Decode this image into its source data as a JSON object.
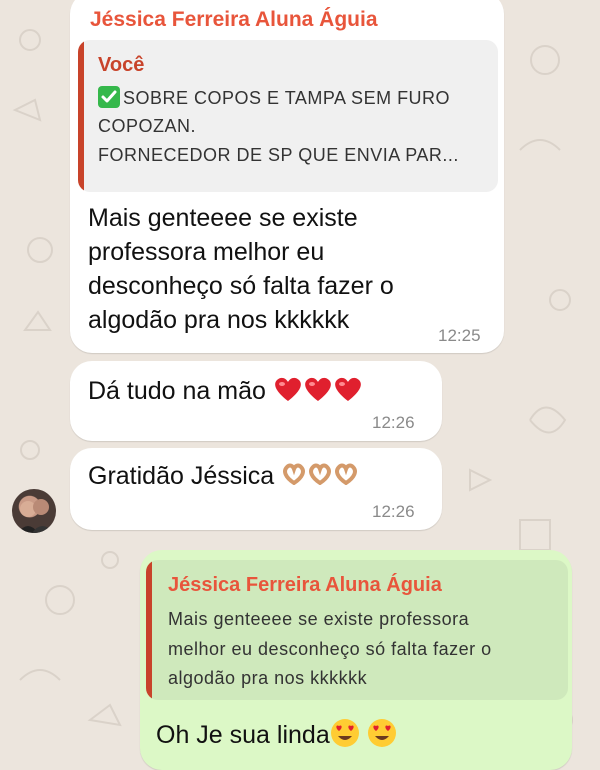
{
  "messages": [
    {
      "sender": "Jéssica Ferreira Aluna Águia",
      "quote_author": "Você",
      "quote_lines": [
        "SOBRE COPOS E TAMPA SEM FURO",
        "COPOZAN.",
        "FORNECEDOR DE SP QUE ENVIA PAR..."
      ],
      "text_lines": [
        "Mais genteeee se existe",
        "professora melhor eu",
        "desconheço só falta fazer o",
        "algodão pra nos kkkkkk"
      ],
      "time": "12:25"
    },
    {
      "text": "Dá tudo na mão",
      "emoji_names": [
        "heart-icon",
        "heart-icon",
        "heart-icon"
      ],
      "time": "12:26"
    },
    {
      "text": "Gratidão Jéssica",
      "emoji_names": [
        "heart-hands-icon",
        "heart-hands-icon",
        "heart-hands-icon"
      ],
      "time": "12:26"
    },
    {
      "quote_author": "Jéssica Ferreira Aluna Águia",
      "quote_lines": [
        "Mais genteeee se existe professora",
        "melhor eu desconheço só falta fazer o",
        "algodão pra nos kkkkkk"
      ],
      "text": "Oh Je sua linda",
      "emoji_names": [
        "heart-eyes-icon",
        "heart-eyes-icon"
      ]
    }
  ],
  "colors": {
    "background": "#ece5dd",
    "incoming_bubble": "#ffffff",
    "outgoing_bubble": "#dcf8c6",
    "sender_name": "#e8553b",
    "quote_accent": "#c8432a",
    "check": "#35b84b"
  }
}
